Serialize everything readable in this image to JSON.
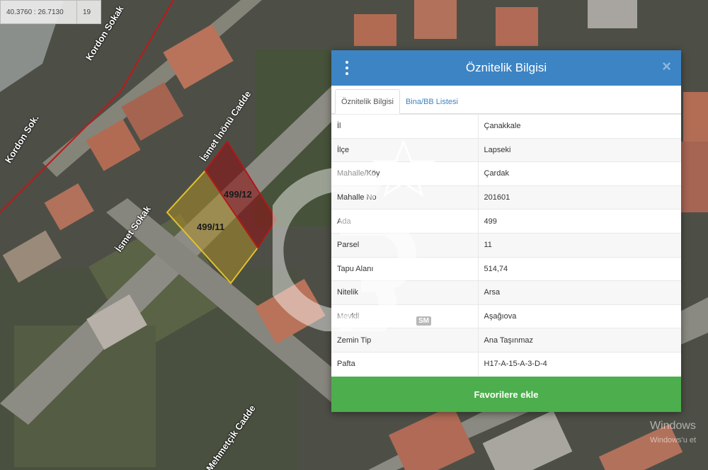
{
  "map": {
    "coords": "40.3760 : 26.7130",
    "zoom": "19",
    "roads": {
      "kordon_sokak_1": "Kordon Sokak",
      "kordon_sokak_2": "Kordon Sok.",
      "ismet_inonu": "İsmet İnönü Cadde",
      "ismet_sokak": "İsmet Sokak",
      "mehmetcik": "Mehmetçik Cadde"
    },
    "parcels": {
      "selected": "499/12",
      "adjacent": "499/11"
    },
    "windows_watermark": {
      "line1": "Windows",
      "line2": "Windows'u et"
    }
  },
  "panel": {
    "title": "Öznitelik Bilgisi",
    "close_symbol": "×",
    "tabs": [
      "Öznitelik Bilgisi",
      "Bina/BB Listesi"
    ],
    "rows": [
      {
        "key": "İl",
        "value": "Çanakkale"
      },
      {
        "key": "İlçe",
        "value": "Lapseki"
      },
      {
        "key": "Mahalle/Köy",
        "value": "Çardak"
      },
      {
        "key": "Mahalle No",
        "value": "201601"
      },
      {
        "key": "Ada",
        "value": "499"
      },
      {
        "key": "Parsel",
        "value": "11"
      },
      {
        "key": "Tapu Alanı",
        "value": "514,74"
      },
      {
        "key": "Nitelik",
        "value": "Arsa"
      },
      {
        "key": "Mevkii",
        "value": "Aşağıova"
      },
      {
        "key": "Zemin Tip",
        "value": "Ana Taşınmaz"
      },
      {
        "key": "Pafta",
        "value": "H17-A-15-A-3-D-4"
      }
    ],
    "favorite_label": "Favorilere ekle"
  },
  "watermark": {
    "badge": "SM"
  },
  "colors": {
    "header": "#3c84c4",
    "favorite": "#4cae4c",
    "selected_parcel": "#b01818",
    "adjacent_parcel": "#e0c030"
  }
}
